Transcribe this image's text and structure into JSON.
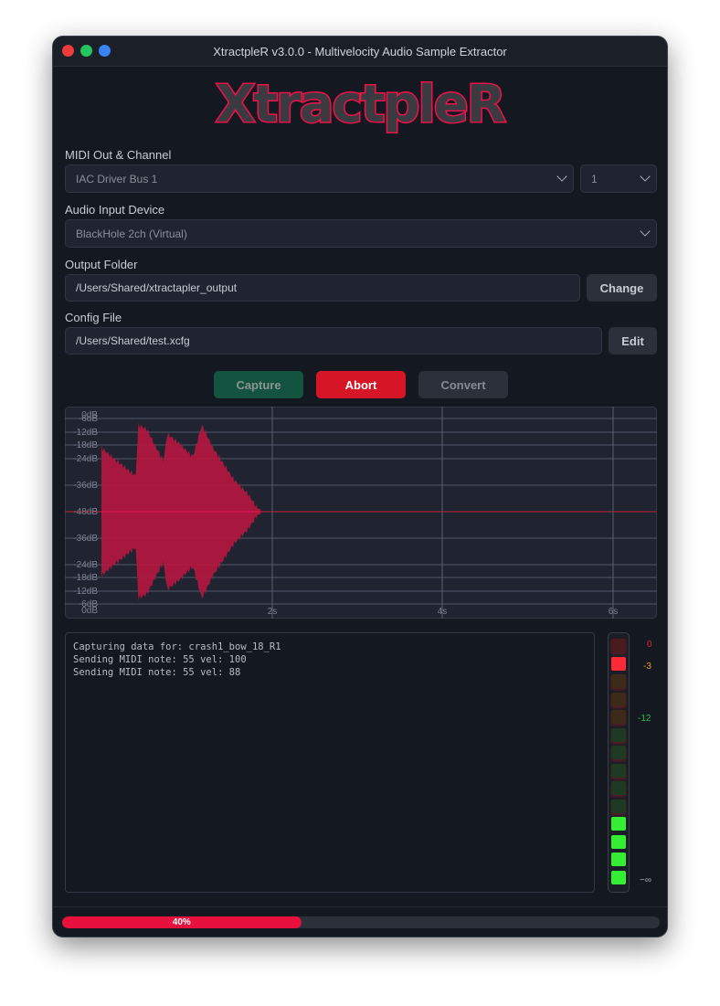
{
  "window": {
    "title": "XtractpleR v3.0.0 - Multivelocity Audio Sample Extractor"
  },
  "logo": "XtractpleR",
  "midi": {
    "label": "MIDI Out & Channel",
    "device": "IAC Driver Bus 1",
    "channel": "1"
  },
  "audio": {
    "label": "Audio Input Device",
    "device": "BlackHole 2ch (Virtual)"
  },
  "output": {
    "label": "Output Folder",
    "path": "/Users/Shared/xtractapler_output",
    "button": "Change"
  },
  "config": {
    "label": "Config File",
    "path": "/Users/Shared/test.xcfg",
    "button": "Edit"
  },
  "actions": {
    "capture": "Capture",
    "abort": "Abort",
    "convert": "Convert"
  },
  "waveform": {
    "db_labels_top": [
      "-6dB",
      "-12dB",
      "-18dB",
      "-24dB",
      "-36dB",
      "-48dB"
    ],
    "db_labels_bottom": [
      "-36dB",
      "-24dB",
      "-18dB",
      "-12dB",
      "-6dB",
      "0dB"
    ],
    "top_zero": "0dB",
    "time_labels": [
      "2s",
      "4s",
      "6s"
    ],
    "color": "#b0183f"
  },
  "log": [
    "Capturing data for: crash1_bow_18_R1",
    "Sending MIDI note: 55 vel: 100",
    "Sending MIDI note: 55 vel: 88"
  ],
  "meter": {
    "labels": {
      "zero": "0",
      "minus3": "-3",
      "minus12": "-12",
      "inf": "−∞"
    },
    "lit_green_segments": 4,
    "peak_segment_lit": true
  },
  "progress": {
    "value": 40,
    "label": "40%"
  },
  "colors": {
    "accent": "#e8103d",
    "capture": "#13533f",
    "abort": "#d61626",
    "convert": "#2b303b"
  }
}
